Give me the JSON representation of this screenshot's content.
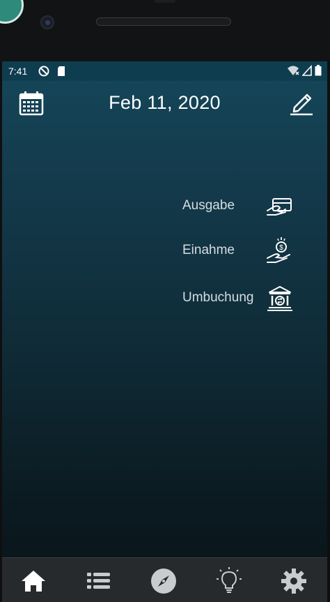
{
  "status_bar": {
    "time": "7:41",
    "icons": [
      "dnd-icon",
      "sd-card-icon",
      "wifi-icon",
      "signal-icon",
      "battery-icon"
    ]
  },
  "header": {
    "date": "Feb 11, 2020",
    "left_icon": "calendar-icon",
    "right_icon": "edit-pencil-icon"
  },
  "actions": [
    {
      "label": "Ausgabe",
      "icon": "card-hand-icon"
    },
    {
      "label": "Einahme",
      "icon": "coin-hand-icon"
    },
    {
      "label": "Umbuchung",
      "icon": "bank-transfer-icon"
    }
  ],
  "bottom_nav": [
    {
      "name": "home",
      "icon": "home-icon",
      "active": true
    },
    {
      "name": "list",
      "icon": "list-icon",
      "active": false
    },
    {
      "name": "explore",
      "icon": "compass-icon",
      "active": false
    },
    {
      "name": "tips",
      "icon": "lightbulb-icon",
      "active": false
    },
    {
      "name": "settings",
      "icon": "gear-icon",
      "active": false
    }
  ],
  "colors": {
    "header_bg": "#0f3d50",
    "text": "#ffffff",
    "action_text": "#d6dde0",
    "nav_bg": "#272a2d",
    "nav_icon": "#c9cccf"
  }
}
